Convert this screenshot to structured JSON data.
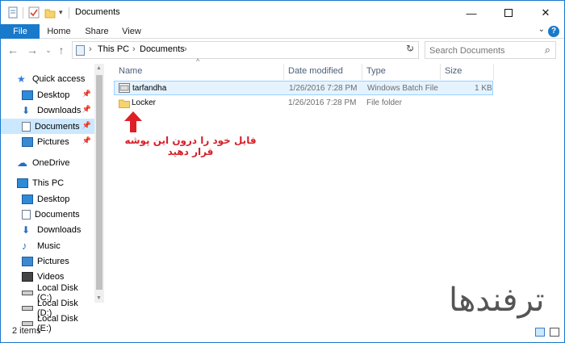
{
  "window": {
    "title": "Documents"
  },
  "ribbon": {
    "tabs": [
      "File",
      "Home",
      "Share",
      "View"
    ],
    "help": "?"
  },
  "address": {
    "segments": [
      "This PC",
      "Documents"
    ]
  },
  "search": {
    "placeholder": "Search Documents"
  },
  "navpane": {
    "items": [
      {
        "label": "Quick access",
        "icon": "star-icon",
        "color": "#2f7fd8"
      },
      {
        "label": "Desktop",
        "icon": "desktop-icon",
        "color": "#2f8ad8",
        "pinned": true
      },
      {
        "label": "Downloads",
        "icon": "download-arrow-icon",
        "color": "#2b6fbf",
        "pinned": true
      },
      {
        "label": "Documents",
        "icon": "document-icon",
        "color": "#6b7b8f",
        "pinned": true,
        "selected": true
      },
      {
        "label": "Pictures",
        "icon": "picture-icon",
        "color": "#3b89d1",
        "pinned": true
      },
      {
        "label": "OneDrive",
        "icon": "cloud-icon",
        "color": "#1e6fc0"
      },
      {
        "label": "This PC",
        "icon": "monitor-icon",
        "color": "#2f8ad8"
      },
      {
        "label": "Desktop",
        "icon": "desktop-icon",
        "color": "#2f8ad8"
      },
      {
        "label": "Documents",
        "icon": "document-icon",
        "color": "#6b7b8f"
      },
      {
        "label": "Downloads",
        "icon": "download-arrow-icon",
        "color": "#2b6fbf"
      },
      {
        "label": "Music",
        "icon": "music-icon",
        "color": "#2b6fbf"
      },
      {
        "label": "Pictures",
        "icon": "picture-icon",
        "color": "#3b89d1"
      },
      {
        "label": "Videos",
        "icon": "film-icon",
        "color": "#444444"
      },
      {
        "label": "Local Disk (C:)",
        "icon": "drive-icon",
        "color": "#555555"
      },
      {
        "label": "Local Disk (D:)",
        "icon": "drive-icon",
        "color": "#555555"
      },
      {
        "label": "Local Disk (E:)",
        "icon": "drive-icon",
        "color": "#555555"
      }
    ]
  },
  "columns": [
    "Name",
    "Date modified",
    "Type",
    "Size"
  ],
  "files": [
    {
      "name": "tarfandha",
      "date": "1/26/2016 7:28 PM",
      "type": "Windows Batch File",
      "size": "1 KB",
      "icon": "batch-file-icon"
    },
    {
      "name": "Locker",
      "date": "1/26/2016 7:28 PM",
      "type": "File folder",
      "size": "",
      "icon": "folder-icon"
    }
  ],
  "annotation": {
    "text": "فایل خود را درون این پوشه قرار دهید",
    "color": "#d81f26"
  },
  "status": {
    "count": "2 items"
  },
  "watermark": {
    "text": "ترفندها"
  },
  "colors": {
    "accent": "#1979ca",
    "selection": "#cce8ff"
  }
}
